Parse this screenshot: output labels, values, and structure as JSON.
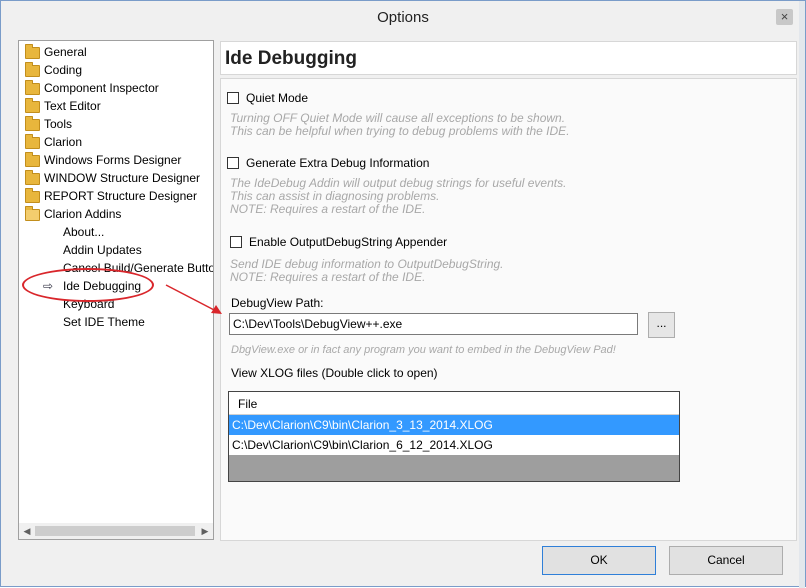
{
  "window": {
    "title": "Options",
    "close_glyph": "×"
  },
  "tree": {
    "items": [
      {
        "label": "General",
        "icon": "folder-icon",
        "level": 0
      },
      {
        "label": "Coding",
        "icon": "folder-icon",
        "level": 0
      },
      {
        "label": "Component Inspector",
        "icon": "folder-icon",
        "level": 0
      },
      {
        "label": "Text Editor",
        "icon": "folder-icon",
        "level": 0
      },
      {
        "label": "Tools",
        "icon": "folder-icon",
        "level": 0
      },
      {
        "label": "Clarion",
        "icon": "folder-icon",
        "level": 0
      },
      {
        "label": "Windows Forms Designer",
        "icon": "folder-icon",
        "level": 0
      },
      {
        "label": "WINDOW Structure Designer",
        "icon": "folder-icon",
        "level": 0
      },
      {
        "label": "REPORT Structure Designer",
        "icon": "folder-icon",
        "level": 0
      },
      {
        "label": "Clarion Addins",
        "icon": "folder-open-icon",
        "level": 0
      },
      {
        "label": "About...",
        "level": 1
      },
      {
        "label": "Addin Updates",
        "level": 1
      },
      {
        "label": "Cancel Build/Generate Butto",
        "level": 1
      },
      {
        "label": "Ide Debugging",
        "level": 1,
        "selected": true
      },
      {
        "label": "Keyboard",
        "level": 1
      },
      {
        "label": "Set IDE Theme",
        "level": 1
      }
    ],
    "selected_marker": "⇨",
    "scroll_left": "◀",
    "scroll_right": "▶"
  },
  "panel": {
    "title": "Ide Debugging",
    "quiet_mode": {
      "label": "Quiet Mode",
      "checked": false,
      "help": "Turning OFF Quiet Mode will cause all exceptions to be shown.\nThis can be helpful when trying to debug problems with the IDE."
    },
    "extra_debug": {
      "label": "Generate Extra Debug Information",
      "checked": false,
      "help": "The IdeDebug Addin will output debug strings for useful events.\nThis can assist in diagnosing problems.\nNOTE: Requires a restart of the IDE."
    },
    "output_appender": {
      "label": "Enable OutputDebugString Appender",
      "checked": false,
      "help": "Send IDE debug information to OutputDebugString.\nNOTE: Requires a restart of the IDE."
    },
    "debugview": {
      "label": "DebugView Path:",
      "value": "C:\\Dev\\Tools\\DebugView++.exe",
      "browse_label": "...",
      "help": "DbgView.exe or in fact any program you want to embed in the DebugView Pad!"
    },
    "xlog": {
      "label": "View XLOG files (Double click to open)",
      "column": "File",
      "files": [
        {
          "name": "C:\\Dev\\Clarion\\C9\\bin\\Clarion_3_13_2014.XLOG",
          "selected": true
        },
        {
          "name": "C:\\Dev\\Clarion\\C9\\bin\\Clarion_6_12_2014.XLOG",
          "selected": false
        }
      ]
    }
  },
  "buttons": {
    "ok": "OK",
    "cancel": "Cancel"
  },
  "colors": {
    "selection": "#3399ff",
    "annotation": "#d9262b",
    "folder": "#e8b63c"
  }
}
